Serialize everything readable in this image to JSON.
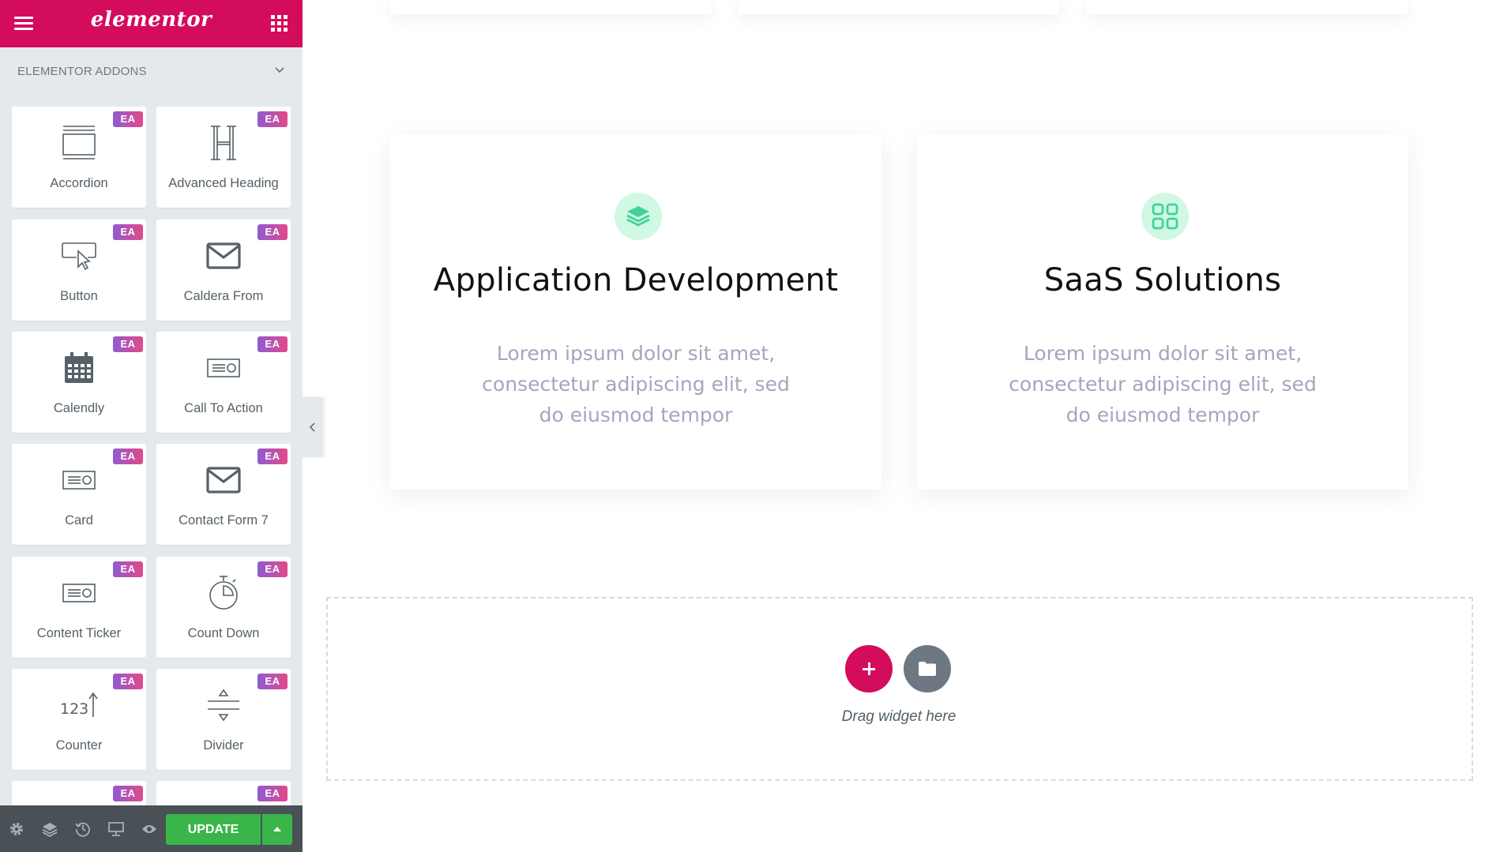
{
  "sidebar": {
    "logo": "elementor",
    "category": "ELEMENTOR ADDONS",
    "badge": "EA",
    "widgets": [
      {
        "label": "Accordion",
        "icon": "accordion-icon"
      },
      {
        "label": "Advanced Heading",
        "icon": "heading-icon"
      },
      {
        "label": "Button",
        "icon": "button-icon"
      },
      {
        "label": "Caldera From",
        "icon": "envelope-icon"
      },
      {
        "label": "Calendly",
        "icon": "calendar-icon"
      },
      {
        "label": "Call To Action",
        "icon": "call-to-action-icon"
      },
      {
        "label": "Card",
        "icon": "card-icon"
      },
      {
        "label": "Contact Form 7",
        "icon": "envelope-icon"
      },
      {
        "label": "Content Ticker",
        "icon": "content-ticker-icon"
      },
      {
        "label": "Count Down",
        "icon": "stopwatch-icon"
      },
      {
        "label": "Counter",
        "icon": "counter-icon"
      },
      {
        "label": "Divider",
        "icon": "divider-icon"
      }
    ],
    "footer": {
      "update_label": "UPDATE"
    }
  },
  "canvas": {
    "cards": [
      {
        "title": "Application Development",
        "text_lines": [
          "Lorem ipsum dolor sit amet,",
          "consectetur adipiscing elit, sed",
          "do eiusmod tempor"
        ],
        "icon": "layers-icon"
      },
      {
        "title": "SaaS Solutions",
        "text_lines": [
          "Lorem ipsum dolor sit amet,",
          "consectetur adipiscing elit, sed",
          "do eiusmod tempor"
        ],
        "icon": "apps-grid-icon"
      }
    ],
    "drop_zone": {
      "drag_text": "Drag widget here"
    }
  },
  "colors": {
    "brand": "#d30c5c",
    "sidebar_bg": "#e6e9ec",
    "footer_bg": "#495157",
    "update_green": "#39b54a",
    "icon_green": "#3fd39a",
    "icon_circle": "#d1f8e3"
  }
}
